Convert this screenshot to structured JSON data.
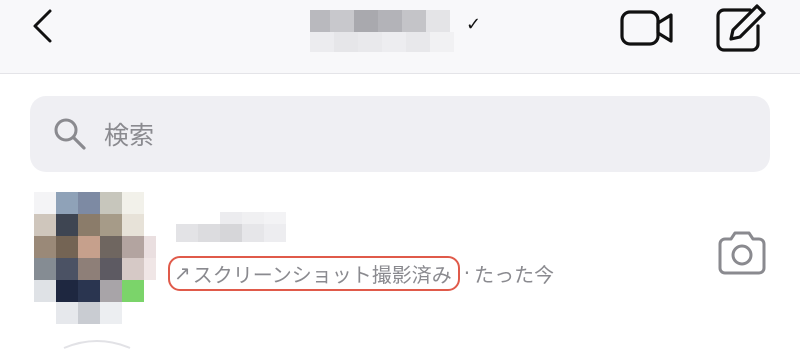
{
  "header": {
    "verified_mark": "✓",
    "icons": {
      "back": "chevron-left-icon",
      "video": "video-camera-icon",
      "compose": "compose-icon"
    }
  },
  "search": {
    "placeholder": "検索",
    "icon": "search-icon"
  },
  "thread": {
    "preview": {
      "arrow": "↗",
      "label": "スクリーンショット撮影済み",
      "separator": "·",
      "time": "たった今"
    },
    "action_icon": "camera-icon"
  },
  "colors": {
    "highlight": "#e05a4a",
    "secondary_text": "#8a8a8f",
    "search_bg": "#efeff3"
  }
}
